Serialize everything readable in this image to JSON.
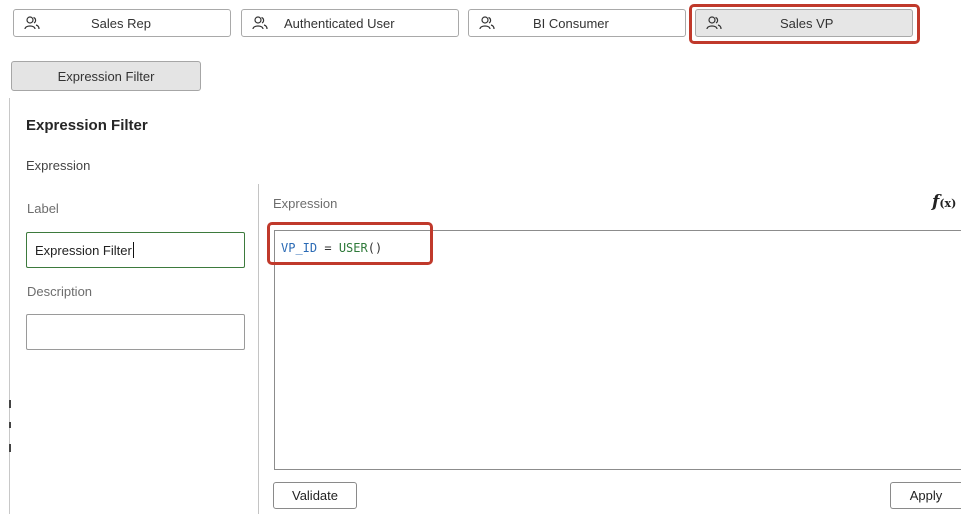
{
  "roles": [
    {
      "label": "Sales Rep",
      "icon": "users-icon",
      "selected": false
    },
    {
      "label": "Authenticated User",
      "icon": "users-icon",
      "selected": false
    },
    {
      "label": "BI Consumer",
      "icon": "users-icon",
      "selected": false
    },
    {
      "label": "Sales VP",
      "icon": "users-icon",
      "selected": true
    }
  ],
  "filter_tab": {
    "label": "Expression Filter"
  },
  "detail": {
    "title": "Expression Filter",
    "subtitle": "Expression",
    "label_caption": "Label",
    "label_value": "Expression Filter",
    "description_caption": "Description",
    "description_value": ""
  },
  "editor": {
    "header": "Expression",
    "fx_symbol": "f",
    "fx_args": "(x)",
    "code": {
      "identifier": "VP_ID",
      "operator": " = ",
      "function": "USER",
      "parens": "()"
    }
  },
  "buttons": {
    "validate": "Validate",
    "apply": "Apply"
  },
  "colors": {
    "highlight": "#c0392b",
    "selected_tab_bg": "#e6e6e6",
    "code_identifier": "#2a6ab5",
    "code_function": "#2f7a3a",
    "focus_border": "#3d7a3d"
  }
}
